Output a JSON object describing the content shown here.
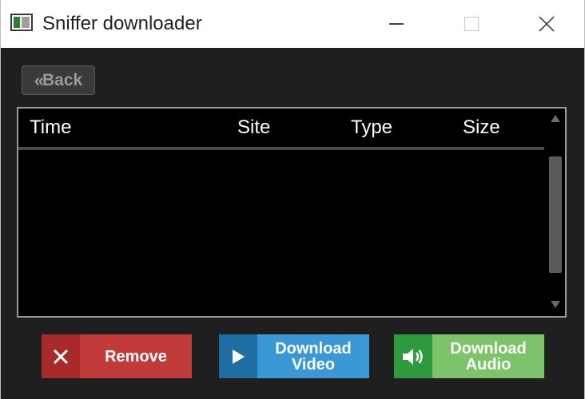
{
  "window": {
    "title": "Sniffer downloader"
  },
  "toolbar": {
    "back_label": "Back",
    "back_chevron": "«"
  },
  "table": {
    "columns": [
      "Time",
      "Site",
      "Type",
      "Size"
    ],
    "rows": []
  },
  "actions": {
    "remove": {
      "label": "Remove"
    },
    "download_video": {
      "line1": "Download",
      "line2": "Video"
    },
    "download_audio": {
      "line1": "Download",
      "line2": "Audio"
    }
  },
  "colors": {
    "background": "#1f1f1f",
    "remove": "#c23b3b",
    "video": "#3a98d6",
    "audio": "#7cc36a"
  },
  "icons": {
    "app": "app-window-icon",
    "remove": "close-x-icon",
    "video": "play-icon",
    "audio": "speaker-icon"
  }
}
